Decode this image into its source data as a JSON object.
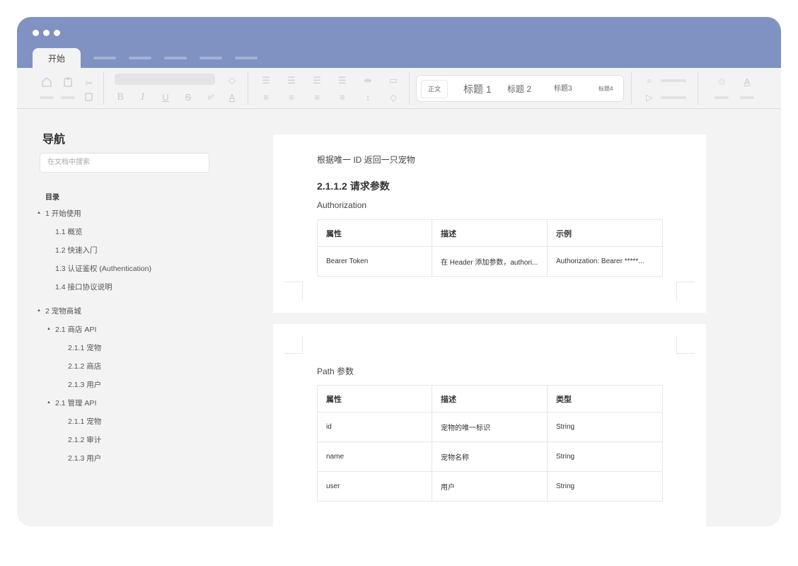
{
  "tabs": {
    "active": "开始"
  },
  "styles": {
    "normal": "正文",
    "h1": "标题 1",
    "h2": "标题 2",
    "h3": "标题3",
    "h4": "标题4"
  },
  "nav": {
    "title": "导航",
    "search_placeholder": "在文档中搜索",
    "toc_label": "目录",
    "items": [
      {
        "label": "1 开始使用"
      },
      {
        "label": "1.1 概览"
      },
      {
        "label": "1.2 快速入门"
      },
      {
        "label": "1.3 认证鉴权 (Authentication)"
      },
      {
        "label": "1.4 接口协议说明"
      },
      {
        "label": "2 宠物商城"
      },
      {
        "label": "2.1 商店 API"
      },
      {
        "label": "2.1.1 宠物"
      },
      {
        "label": "2.1.2 商店"
      },
      {
        "label": "2.1.3 用户"
      },
      {
        "label": "2.1 管理 API"
      },
      {
        "label": "2.1.1 宠物"
      },
      {
        "label": "2.1.2 审计"
      },
      {
        "label": "2.1.3 用户"
      }
    ]
  },
  "page1": {
    "intro": "根据唯一 ID 返回一只宠物",
    "heading": "2.1.1.2 请求参数",
    "subheading": "Authorization",
    "table": {
      "headers": [
        "属性",
        "描述",
        "示例"
      ],
      "rows": [
        [
          "Bearer Token",
          "在 Header 添加参数，authori...",
          "Authorization: Bearer *****..."
        ]
      ]
    }
  },
  "page2": {
    "subheading": "Path 参数",
    "table": {
      "headers": [
        "属性",
        "描述",
        "类型"
      ],
      "rows": [
        [
          "id",
          "宠物的唯一标识",
          "String"
        ],
        [
          "name",
          "宠物名称",
          "String"
        ],
        [
          "user",
          "用户",
          "String"
        ]
      ]
    }
  }
}
